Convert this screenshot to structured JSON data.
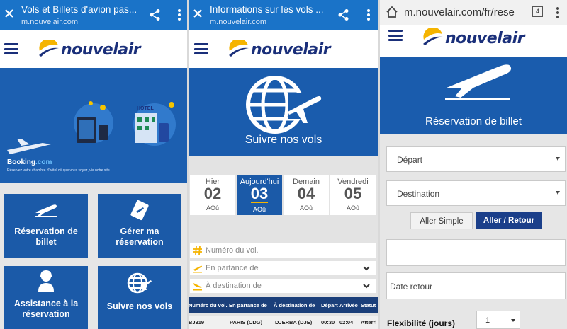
{
  "panel1": {
    "tab_title": "Vols et Billets d'avion pas...",
    "tab_url": "m.nouvelair.com",
    "logo_text": "nouvelair",
    "banner": {
      "hotel_sign": "HOTEL",
      "booking_brand": "Booking",
      "booking_suffix": ".com",
      "booking_tagline": "Réservez votre chambre d'hôtel où que vous soyez, via notre site."
    },
    "tiles": [
      {
        "label_line1": "Réservation de",
        "label_line2": "billet"
      },
      {
        "label_line1": "Gérer ma",
        "label_line2": "réservation"
      },
      {
        "label_line1": "Assistance à la",
        "label_line2": "réservation"
      },
      {
        "label_line1": "Suivre nos vols",
        "label_line2": ""
      }
    ]
  },
  "panel2": {
    "tab_title": "Informations sur les vols ...",
    "tab_url": "m.nouvelair.com",
    "logo_text": "nouvelair",
    "hero_title": "Suivre nos vols",
    "days": [
      {
        "name": "Hier",
        "num": "02",
        "month": "AOû"
      },
      {
        "name": "Aujourd'hui",
        "num": "03",
        "month": "AOû"
      },
      {
        "name": "Demain",
        "num": "04",
        "month": "AOû"
      },
      {
        "name": "Vendredi",
        "num": "05",
        "month": "AOû"
      }
    ],
    "flight_number_placeholder": "Numéro du vol.",
    "departure_placeholder": "En partance de",
    "destination_placeholder": "À destination de",
    "table": {
      "headers": [
        "Numéro du vol.",
        "En partance de",
        "À destination de",
        "Départ",
        "Arrivée",
        "Statut"
      ],
      "rows": [
        [
          "BJ319",
          "PARIS (CDG)",
          "DJERBA (DJE)",
          "00:30",
          "02:04",
          "Atterri"
        ]
      ]
    }
  },
  "panel3": {
    "address_url": "m.nouvelair.com/fr/rese",
    "tab_count": "4",
    "logo_text": "nouvelair",
    "hero_title": "Réservation de billet",
    "departure_label": "Départ",
    "destination_label": "Destination",
    "one_way_label": "Aller Simple",
    "round_trip_label": "Aller / Retour",
    "return_date_label": "Date retour",
    "flexibility_label": "Flexibilité (jours)",
    "flexibility_value": "1"
  },
  "colors": {
    "chrome_blue": "#1a73c8",
    "brand_blue": "#1b5aa8",
    "navy": "#1a2f7a",
    "sun_yellow": "#f5b400"
  }
}
